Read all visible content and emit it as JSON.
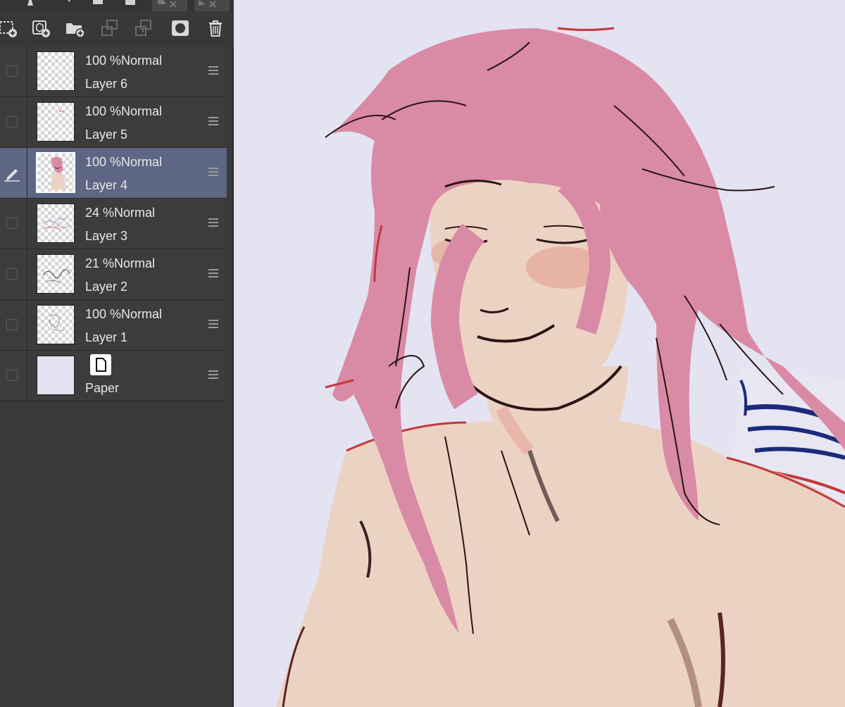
{
  "layers_panel": {
    "tools": [
      {
        "icon": "new-raster-layer-icon"
      },
      {
        "icon": "new-vector-layer-icon"
      },
      {
        "icon": "new-folder-icon"
      },
      {
        "icon": "transfer-down-icon"
      },
      {
        "icon": "merge-down-icon"
      },
      {
        "icon": "mask-icon"
      },
      {
        "icon": "trash-icon"
      }
    ],
    "layers": [
      {
        "opacity": "100 %",
        "blend": "Normal",
        "name": "Layer 6",
        "active": false
      },
      {
        "opacity": "100 %",
        "blend": "Normal",
        "name": "Layer 5",
        "active": false
      },
      {
        "opacity": "100 %",
        "blend": "Normal",
        "name": "Layer 4",
        "active": true
      },
      {
        "opacity": "24 %",
        "blend": "Normal",
        "name": "Layer 3",
        "active": false
      },
      {
        "opacity": "21 %",
        "blend": "Normal",
        "name": "Layer 2",
        "active": false
      },
      {
        "opacity": "100 %",
        "blend": "Normal",
        "name": "Layer 1",
        "active": false
      }
    ],
    "paper": {
      "name": "Paper",
      "color": "#e4e3f1"
    }
  },
  "colors": {
    "canvas_bg": "#e4e3f1",
    "active_layer": "#5d6683",
    "hair": "#d98aa5",
    "skin": "#ecd2c2"
  }
}
